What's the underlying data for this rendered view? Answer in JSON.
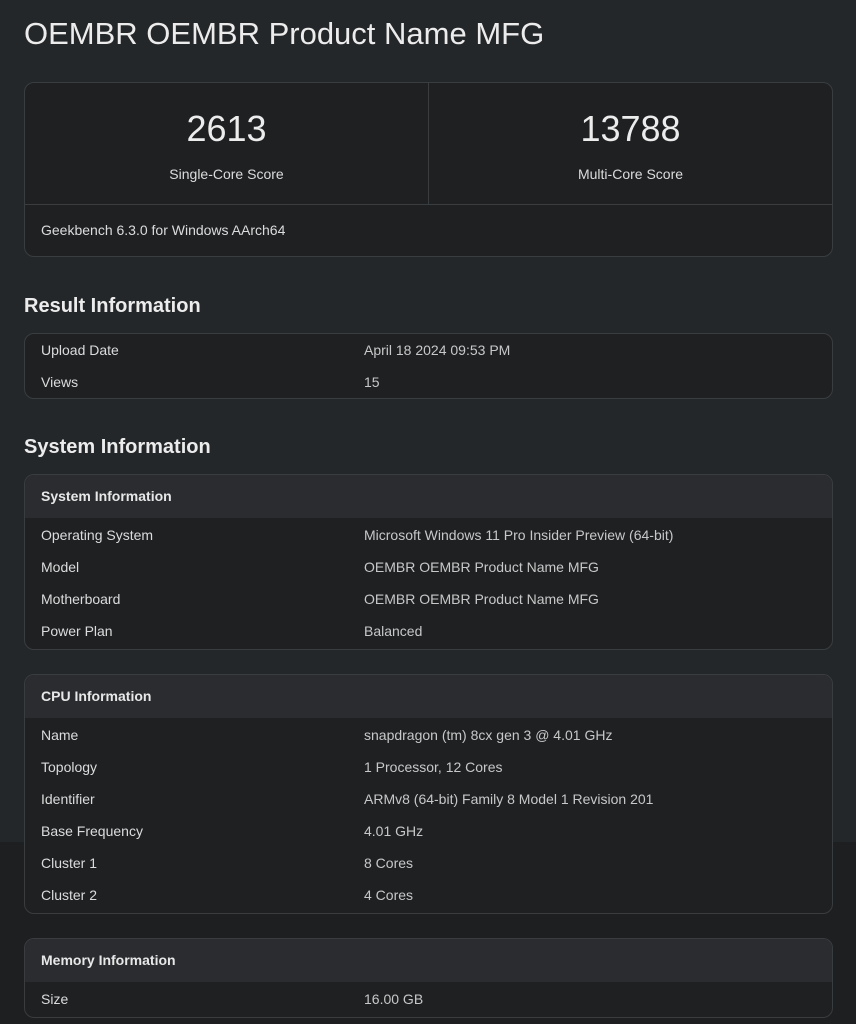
{
  "page": {
    "title": "OEMBR OEMBR Product Name MFG"
  },
  "scores": {
    "single": {
      "value": "2613",
      "label": "Single-Core Score"
    },
    "multi": {
      "value": "13788",
      "label": "Multi-Core Score"
    },
    "version": "Geekbench 6.3.0 for Windows AArch64"
  },
  "result_info": {
    "heading": "Result Information",
    "rows": [
      {
        "key": "Upload Date",
        "value": "April 18 2024 09:53 PM"
      },
      {
        "key": "Views",
        "value": "15"
      }
    ]
  },
  "system_section": {
    "heading": "System Information"
  },
  "system_info": {
    "title": "System Information",
    "rows": [
      {
        "key": "Operating System",
        "value": "Microsoft Windows 11 Pro Insider Preview (64-bit)"
      },
      {
        "key": "Model",
        "value": "OEMBR OEMBR Product Name MFG"
      },
      {
        "key": "Motherboard",
        "value": "OEMBR OEMBR Product Name MFG"
      },
      {
        "key": "Power Plan",
        "value": "Balanced"
      }
    ]
  },
  "cpu_info": {
    "title": "CPU Information",
    "rows": [
      {
        "key": "Name",
        "value": "snapdragon (tm) 8cx gen 3 @ 4.01 GHz"
      },
      {
        "key": "Topology",
        "value": "1 Processor, 12 Cores"
      },
      {
        "key": "Identifier",
        "value": "ARMv8 (64-bit) Family 8 Model 1 Revision 201"
      },
      {
        "key": "Base Frequency",
        "value": "4.01 GHz"
      },
      {
        "key": "Cluster 1",
        "value": "8 Cores"
      },
      {
        "key": "Cluster 2",
        "value": "4 Cores"
      }
    ]
  },
  "memory_info": {
    "title": "Memory Information",
    "rows": [
      {
        "key": "Size",
        "value": "16.00 GB"
      }
    ]
  }
}
